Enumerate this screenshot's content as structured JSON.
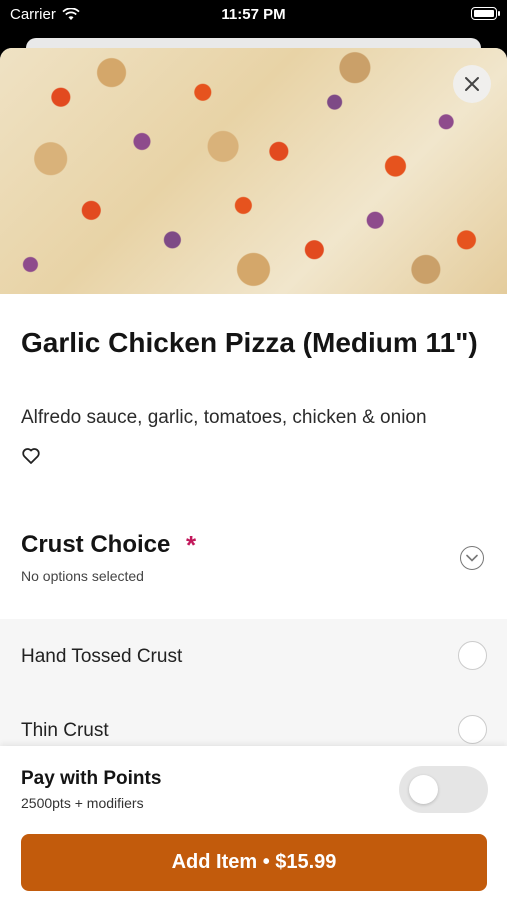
{
  "status_bar": {
    "carrier": "Carrier",
    "time": "11:57 PM"
  },
  "item": {
    "title": "Garlic Chicken Pizza (Medium 11\")",
    "description": "Alfredo sauce, garlic, tomatoes, chicken & onion"
  },
  "crust_section": {
    "title": "Crust Choice",
    "required_mark": "*",
    "subtitle": "No options selected",
    "options": [
      {
        "label": "Hand Tossed Crust"
      },
      {
        "label": "Thin Crust"
      }
    ]
  },
  "points": {
    "title": "Pay with Points",
    "subtitle": "2500pts + modifiers",
    "enabled": false
  },
  "add_button": {
    "label": "Add Item • $15.99",
    "color": "#c25b0c"
  },
  "colors": {
    "required": "#c2185b",
    "accent": "#c25b0c"
  }
}
